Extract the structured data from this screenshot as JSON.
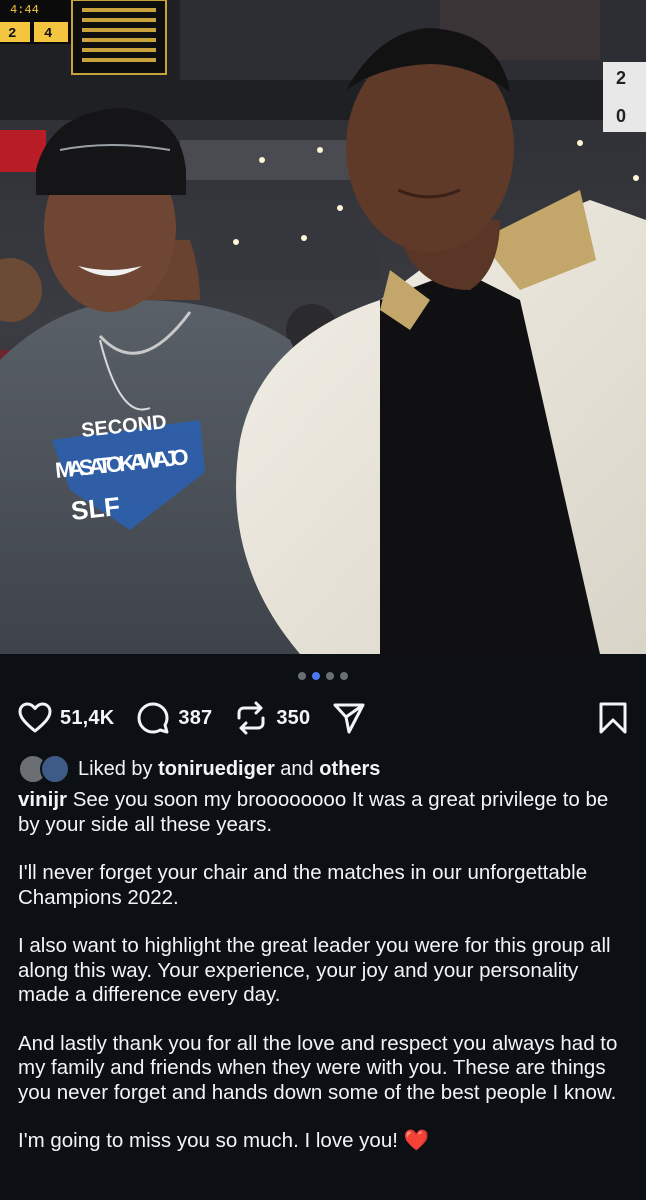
{
  "post": {
    "carousel_index": 1,
    "carousel_count": 4,
    "photo_text": {
      "shirt_line1": "SECOND",
      "shirt_line2": "MASATO KAWAJO",
      "shirt_line3": "SLF",
      "clock": "4:44",
      "score_left": "2",
      "score_right": "4",
      "board_top": "2",
      "board_bottom": "0"
    }
  },
  "actions": {
    "likes": "51,4K",
    "comments": "387",
    "reposts": "350",
    "like_icon": "heart-outline-icon",
    "comment_icon": "speech-bubble-icon",
    "repost_icon": "repost-arrows-icon",
    "share_icon": "paper-plane-icon",
    "save_icon": "bookmark-icon"
  },
  "liked_by": {
    "prefix": "Liked by",
    "user": "toniruediger",
    "joiner": "and",
    "others": "others"
  },
  "caption": {
    "username": "vinijr",
    "paragraphs": [
      "See you soon my broooooooo It was a great privilege to be by your side all these years.",
      "I'll never forget your chair and the matches in our unforgettable Champions 2022.",
      "I also want to highlight the great leader you were for this group all along this way. Your experience, your joy and your personality made a difference every day.",
      "And lastly thank you for all the love and respect you always had to my family and friends when they were with you. These are things you never forget and hands down some of the best people I know.",
      "I'm going to miss you so much. I love you!"
    ],
    "emoji": "❤️"
  },
  "colors": {
    "background": "#0c1014",
    "active_dot": "#4a78f0",
    "heart_emoji": "#e0232f"
  }
}
